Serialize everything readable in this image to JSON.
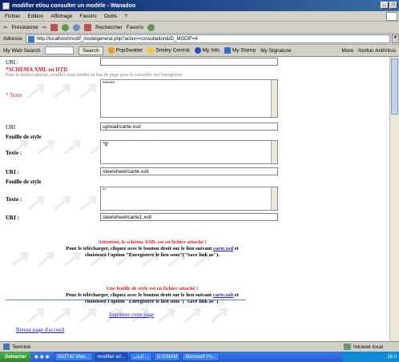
{
  "window": {
    "title": "modifier et/ou consulter un modèle - Wanadoo"
  },
  "menu": [
    "Fichier",
    "Edition",
    "Affichage",
    "Favoris",
    "Outils",
    "?"
  ],
  "toolbar": {
    "back": "Précédente",
    "search": "Rechercher",
    "favorites": "Favoris"
  },
  "address": {
    "label": "Adresse",
    "url": "http://localhost/modif_modelgeneral.php?action=consultation&ID_MODIF=4"
  },
  "searchbar": {
    "mywebsearch": "My Web Search",
    "search": "Search",
    "popswatter": "PopSwatter",
    "smiley": "Smiley Central",
    "myinfo": "My Info",
    "mystamp": "My Stamp",
    "mysignature": "My Signature",
    "more": "More",
    "antivirus": "Norton AntiVirus"
  },
  "form": {
    "uri_label": "URI :",
    "uri_value": "",
    "schema_title": "*SCHEMA XML ou DTD",
    "schema_note": "Pour le fichier attaché, veuillez vous rendre en bas de page pour le consulter ou l'enregistrer.",
    "texte_label": "* Texte",
    "texte_value": "******",
    "uri2_label": "URI",
    "uri2_value": "upload/carte.xsd",
    "style1_title": "Feuille de style",
    "texte1_label": "Texte :",
    "texte1_value": "\"$\"",
    "uri3_label": "URI :",
    "uri3_value": "steelsheet/carte.xslt",
    "style2_title": "Feuille de style",
    "texte2_label": "Texte :",
    "texte2_value": "\"\"",
    "uri4_label": "URI :",
    "uri4_value": "steelsheet/carte1.xslt"
  },
  "notice1": {
    "title": "Attention, le schéma XML est en fichier attaché !",
    "line1_before": "Pour le télécharger, cliquez avec le bouton droit sur le lien suivant",
    "link": "carte.xsd",
    "line1_after": "et",
    "line2": "choisissez l'option \"Enregistrer le lien sous\"(\"Save link as\")."
  },
  "notice2": {
    "title": "Une feuille de style est en fichier attaché !",
    "line1_before": "Pour le télécharger, cliquez avec le bouton droit sur le lien suivant",
    "link": "carte.xslt",
    "line1_after": "et",
    "line2": "choisissez l'option \"Enregistrer le lien sous\"(\"Save link as\")."
  },
  "links": {
    "print": "Imprimer cette page",
    "home": "Retour page d'accueil"
  },
  "status": {
    "text": "Terminé",
    "zone": "Intranet local"
  },
  "taskbar": {
    "start": "Démarrer",
    "tasks": [
      "INOT42 Wan...",
      "modifier et/...",
      "الباب‎ ...",
      "G:\\CNAM",
      "Microsoft Po..."
    ],
    "clock": "16:0"
  }
}
